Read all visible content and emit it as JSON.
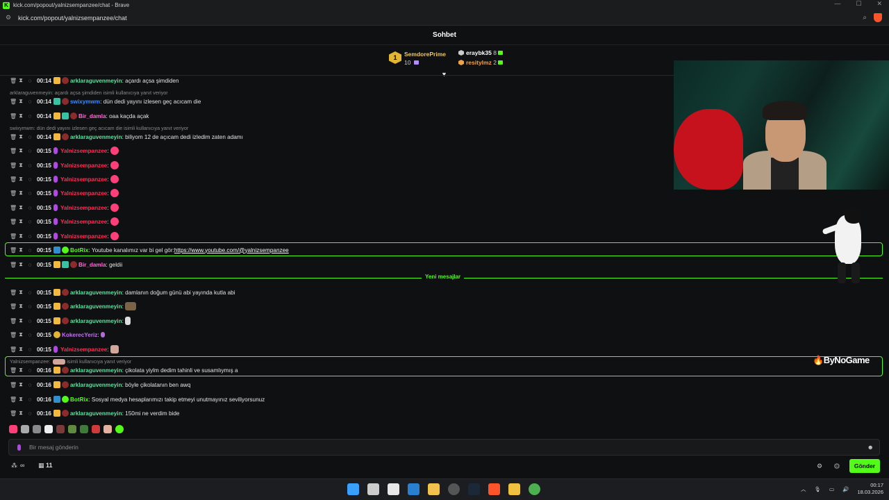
{
  "browser": {
    "title": "kick.com/popout/yalnizsempanzee/chat - Brave",
    "url": "kick.com/popout/yalnizsempanzee/chat"
  },
  "chat": {
    "header": "Sohbet",
    "pinned": {
      "rank": "1",
      "user1": "SemdorePrime",
      "user1_count": "10",
      "user2": "eraybk35",
      "user2_count": "8",
      "user3": "resitylmz",
      "user3_count": "2"
    },
    "messages": [
      {
        "time": "00:14",
        "user": "arklaraguvenmeyin",
        "text": "açardı açsa şimdiden"
      },
      {
        "reply": "arklaraguvenmeyin: açardı açsa şimdiden isimli kullanıcıya yanıt veriyor"
      },
      {
        "time": "00:14",
        "user": "swixymwm",
        "text": "dün dedi yayını izlesen geç acıcam die"
      },
      {
        "time": "00:14",
        "user": "Bir_damla",
        "text": "oaa kaçda açak"
      },
      {
        "reply": "swixymwm: dün dedi yayını izlesen geç acıcam die isimli kullanıcıya yanıt veriyor"
      },
      {
        "time": "00:14",
        "user": "arklaraguvenmeyin",
        "text": "biliyom 12 de açıcam dedi izledim zaten adamı"
      },
      {
        "time": "00:15",
        "user": "Yalnizsempanzee",
        "text": ""
      },
      {
        "time": "00:15",
        "user": "Yalnizsempanzee",
        "text": ""
      },
      {
        "time": "00:15",
        "user": "Yalnizsempanzee",
        "text": ""
      },
      {
        "time": "00:15",
        "user": "Yalnizsempanzee",
        "text": ""
      },
      {
        "time": "00:15",
        "user": "Yalnizsempanzee",
        "text": ""
      },
      {
        "time": "00:15",
        "user": "Yalnizsempanzee",
        "text": ""
      },
      {
        "time": "00:15",
        "user": "Yalnizsempanzee",
        "text": ""
      },
      {
        "time": "00:15",
        "user": "BotRix",
        "text": "Youtube kanalımız var bi gel gör: ",
        "link": "https://www.youtube.com/@yalnizsempanzee"
      },
      {
        "time": "00:15",
        "user": "Bir_damla",
        "text": "geldii"
      },
      {
        "time": "00:15",
        "user": "arklaraguvenmeyin",
        "text": "damlanın doğum günü abi yayında kutla abi"
      },
      {
        "time": "00:15",
        "user": "arklaraguvenmeyin",
        "text": ""
      },
      {
        "time": "00:15",
        "user": "arklaraguvenmeyin",
        "text": ""
      },
      {
        "time": "00:15",
        "user": "KokerecYeriz",
        "text": ""
      },
      {
        "time": "00:15",
        "user": "Yalnizsempanzee",
        "text": ""
      },
      {
        "reply_user": "Yalnizsempanzee:",
        "reply_suffix": "isimli kullanıcıya yanıt veriyor"
      },
      {
        "time": "00:16",
        "user": "arklaraguvenmeyin",
        "text": "çikolata yiylm dedim tahinli ve susamlıymış a"
      },
      {
        "time": "00:16",
        "user": "arklaraguvenmeyin",
        "text": "böyle çikolatanın ben awq"
      },
      {
        "time": "00:16",
        "user": "BotRix",
        "text": "Sosyal medya hesaplarımızı takip etmeyi unutmayınız seviliyorsunuz"
      },
      {
        "time": "00:16",
        "user": "arklaraguvenmeyin",
        "text": "150mi ne verdim bide"
      }
    ],
    "new_messages_label": "Yeni mesajlar",
    "input_placeholder": "Bir mesaj gönderin",
    "send_label": "Gönder",
    "store_count": "11",
    "sponsor": "ByNoGame"
  },
  "taskbar": {
    "time": "00:17",
    "date": "18.03.2026"
  },
  "colors": {
    "accent": "#53fc18",
    "bg": "#0f1011"
  }
}
